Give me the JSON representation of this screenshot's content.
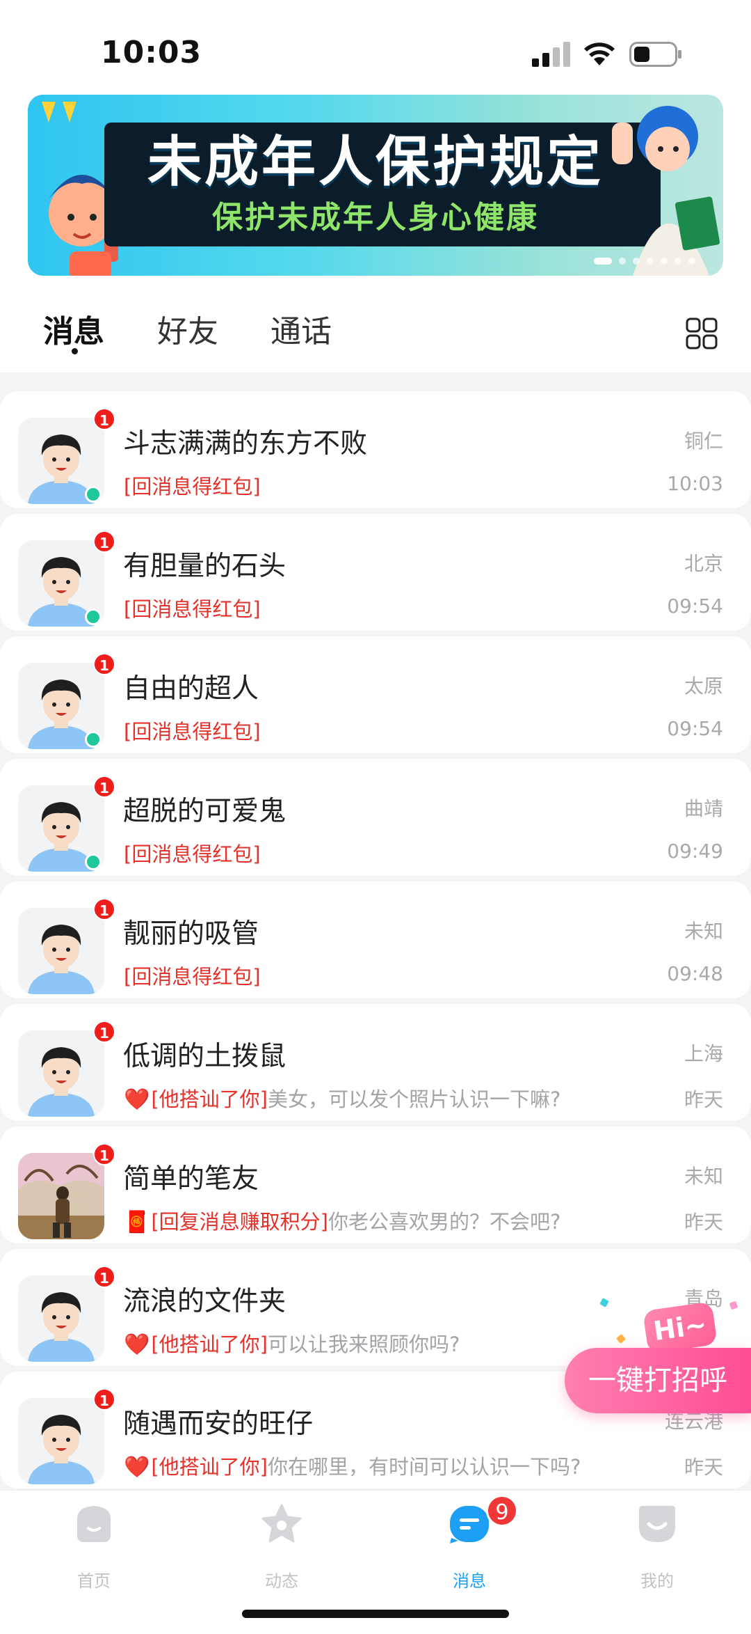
{
  "status_bar": {
    "time": "10:03"
  },
  "banner": {
    "title": "未成年人保护规定",
    "subtitle": "保护未成年人身心健康",
    "slide_count": 7,
    "active_slide": 1
  },
  "tabs": [
    {
      "label": "消息",
      "active": true
    },
    {
      "label": "好友",
      "active": false
    },
    {
      "label": "通话",
      "active": false
    }
  ],
  "conversations": [
    {
      "name": "斗志满满的东方不败",
      "location": "铜仁",
      "time": "10:03",
      "badge": "1",
      "online": true,
      "avatar": "cartoon",
      "emoji": "",
      "tag": "[回消息得红包]",
      "message": ""
    },
    {
      "name": "有胆量的石头",
      "location": "北京",
      "time": "09:54",
      "badge": "1",
      "online": true,
      "avatar": "cartoon",
      "emoji": "",
      "tag": "[回消息得红包]",
      "message": ""
    },
    {
      "name": "自由的超人",
      "location": "太原",
      "time": "09:54",
      "badge": "1",
      "online": true,
      "avatar": "cartoon",
      "emoji": "",
      "tag": "[回消息得红包]",
      "message": ""
    },
    {
      "name": "超脱的可爱鬼",
      "location": "曲靖",
      "time": "09:49",
      "badge": "1",
      "online": true,
      "avatar": "cartoon",
      "emoji": "",
      "tag": "[回消息得红包]",
      "message": ""
    },
    {
      "name": "靓丽的吸管",
      "location": "未知",
      "time": "09:48",
      "badge": "1",
      "online": false,
      "avatar": "cartoon",
      "emoji": "",
      "tag": "[回消息得红包]",
      "message": ""
    },
    {
      "name": "低调的土拨鼠",
      "location": "上海",
      "time": "昨天",
      "badge": "1",
      "online": false,
      "avatar": "cartoon",
      "emoji": "❤️",
      "tag": "[他搭讪了你]",
      "message": "美女，可以发个照片认识一下嘛?"
    },
    {
      "name": "简单的笔友",
      "location": "未知",
      "time": "昨天",
      "badge": "1",
      "online": false,
      "avatar": "photo",
      "emoji": "🧧",
      "tag": "[回复消息赚取积分]",
      "message": "你老公喜欢男的？不会吧?"
    },
    {
      "name": "流浪的文件夹",
      "location": "青岛",
      "time": "",
      "badge": "1",
      "online": false,
      "avatar": "cartoon",
      "emoji": "❤️",
      "tag": "[他搭讪了你]",
      "message": "可以让我来照顾你吗?"
    },
    {
      "name": "随遇而安的旺仔",
      "location": "连云港",
      "time": "昨天",
      "badge": "1",
      "online": false,
      "avatar": "cartoon",
      "emoji": "❤️",
      "tag": "[他搭讪了你]",
      "message": "你在哪里，有时间可以认识一下吗?"
    }
  ],
  "greet": {
    "hi_label": "Hi~",
    "button_label": "一键打招呼"
  },
  "bottom_nav": [
    {
      "label": "首页",
      "icon": "home-icon",
      "active": false,
      "badge": ""
    },
    {
      "label": "动态",
      "icon": "star-icon",
      "active": false,
      "badge": ""
    },
    {
      "label": "消息",
      "icon": "message-icon",
      "active": true,
      "badge": "9"
    },
    {
      "label": "我的",
      "icon": "profile-icon",
      "active": false,
      "badge": ""
    }
  ],
  "colors": {
    "accent_blue": "#1c9ff5",
    "badge_red": "#f01d1d",
    "online_green": "#1fc89b",
    "tag_red": "#e5312a",
    "greet_pink": "#ff4d93"
  }
}
